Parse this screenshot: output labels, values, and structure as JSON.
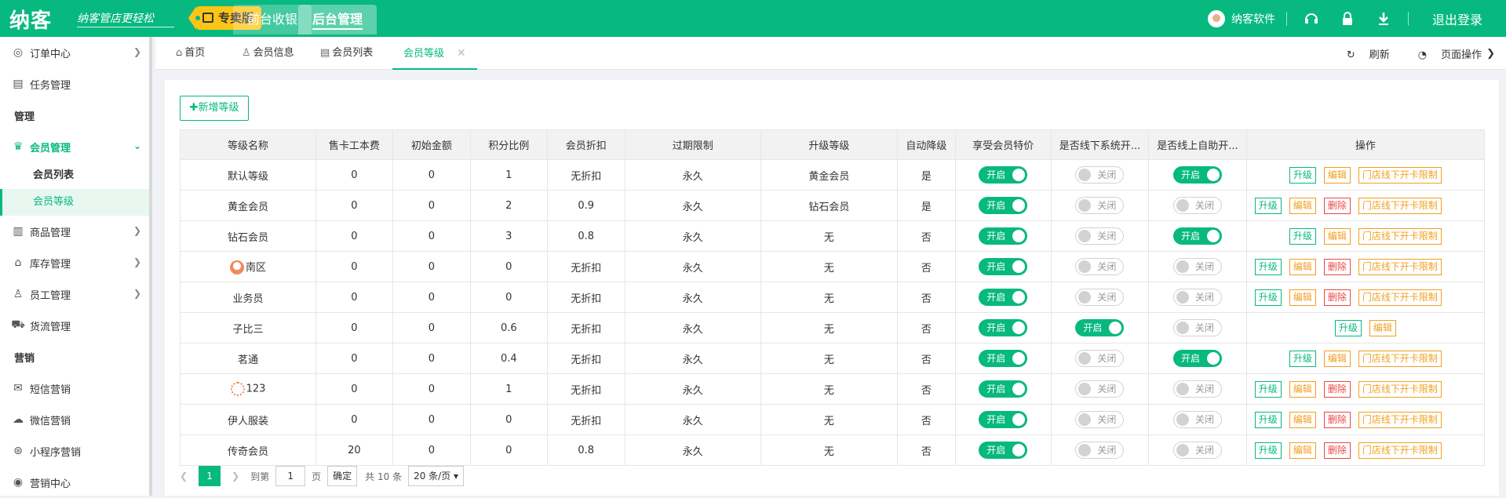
{
  "app": {
    "logo": "纳客",
    "slogan": "纳客管店更轻松",
    "edition": "专卖版"
  },
  "topnav": [
    {
      "label": "前台收银"
    },
    {
      "label": "后台管理"
    }
  ],
  "user": {
    "name": "纳客软件",
    "logout": "退出登录"
  },
  "sidebar": {
    "items": [
      {
        "label": "订单中心",
        "icon": "globe-icon"
      },
      {
        "label": "任务管理",
        "icon": "task-icon"
      },
      {
        "label": "管理"
      },
      {
        "label": "会员管理",
        "icon": "crown-icon"
      },
      {
        "label": "会员列表"
      },
      {
        "label": "会员等级"
      },
      {
        "label": "商品管理",
        "icon": "goods-icon"
      },
      {
        "label": "库存管理",
        "icon": "warehouse-icon"
      },
      {
        "label": "员工管理",
        "icon": "person-icon"
      },
      {
        "label": "货流管理",
        "icon": "truck-icon"
      },
      {
        "label": "营销"
      },
      {
        "label": "短信营销",
        "icon": "mail-icon"
      },
      {
        "label": "微信营销",
        "icon": "wechat-icon"
      },
      {
        "label": "小程序营销",
        "icon": "miniapp-icon"
      },
      {
        "label": "营销中心",
        "icon": "target-icon"
      }
    ]
  },
  "tabs": [
    {
      "label": "首页"
    },
    {
      "label": "会员信息"
    },
    {
      "label": "会员列表"
    },
    {
      "label": "会员等级"
    }
  ],
  "tabbar": {
    "refresh": "刷新",
    "page_ops": "页面操作"
  },
  "toolbar": {
    "add_level": "新增等级"
  },
  "table": {
    "headers": [
      "等级名称",
      "售卡工本费",
      "初始金额",
      "积分比例",
      "会员折扣",
      "过期限制",
      "升级等级",
      "自动降级",
      "享受会员特价",
      "是否线下系统开...",
      "是否线上自助开...",
      "操作"
    ],
    "toggle_on": "开启",
    "toggle_off": "关闭",
    "actions": {
      "upgrade": "升级",
      "edit": "编辑",
      "delete": "删除",
      "limit": "门店线下开卡限制"
    },
    "rows": [
      {
        "name": "默认等级",
        "fee": "0",
        "init": "0",
        "ratio": "1",
        "discount": "无折扣",
        "expire": "永久",
        "upgrade_to": "黄金会员",
        "auto_down": "是",
        "special": true,
        "offline": false,
        "online": true,
        "del": false,
        "limit": true
      },
      {
        "name": "黄金会员",
        "fee": "0",
        "init": "0",
        "ratio": "2",
        "discount": "0.9",
        "expire": "永久",
        "upgrade_to": "钻石会员",
        "auto_down": "是",
        "special": true,
        "offline": false,
        "online": false,
        "del": true,
        "limit": true
      },
      {
        "name": "钻石会员",
        "fee": "0",
        "init": "0",
        "ratio": "3",
        "discount": "0.8",
        "expire": "永久",
        "upgrade_to": "无",
        "auto_down": "否",
        "special": true,
        "offline": false,
        "online": true,
        "del": false,
        "limit": true
      },
      {
        "name": "南区",
        "fee": "0",
        "init": "0",
        "ratio": "0",
        "discount": "无折扣",
        "expire": "永久",
        "upgrade_to": "无",
        "auto_down": "否",
        "special": true,
        "offline": false,
        "online": false,
        "del": true,
        "limit": true,
        "icon": "level-badge-icon"
      },
      {
        "name": "业务员",
        "fee": "0",
        "init": "0",
        "ratio": "0",
        "discount": "无折扣",
        "expire": "永久",
        "upgrade_to": "无",
        "auto_down": "否",
        "special": true,
        "offline": false,
        "online": false,
        "del": true,
        "limit": true
      },
      {
        "name": "子比三",
        "fee": "0",
        "init": "0",
        "ratio": "0.6",
        "discount": "无折扣",
        "expire": "永久",
        "upgrade_to": "无",
        "auto_down": "否",
        "special": true,
        "offline": true,
        "online": false,
        "del": false,
        "limit": false
      },
      {
        "name": "茗通",
        "fee": "0",
        "init": "0",
        "ratio": "0.4",
        "discount": "无折扣",
        "expire": "永久",
        "upgrade_to": "无",
        "auto_down": "否",
        "special": true,
        "offline": false,
        "online": true,
        "del": false,
        "limit": true
      },
      {
        "name": "123",
        "fee": "0",
        "init": "0",
        "ratio": "1",
        "discount": "无折扣",
        "expire": "永久",
        "upgrade_to": "无",
        "auto_down": "否",
        "special": true,
        "offline": false,
        "online": false,
        "del": true,
        "limit": true,
        "icon": "level-ring-icon"
      },
      {
        "name": "伊人服装",
        "fee": "0",
        "init": "0",
        "ratio": "0",
        "discount": "无折扣",
        "expire": "永久",
        "upgrade_to": "无",
        "auto_down": "否",
        "special": true,
        "offline": false,
        "online": false,
        "del": true,
        "limit": true
      },
      {
        "name": "传奇会员",
        "fee": "20",
        "init": "0",
        "ratio": "0",
        "discount": "0.8",
        "expire": "永久",
        "upgrade_to": "无",
        "auto_down": "否",
        "special": true,
        "offline": false,
        "online": false,
        "del": true,
        "limit": true
      }
    ]
  },
  "pagination": {
    "current": "1",
    "goto_label": "到第",
    "page_value": "1",
    "page_unit": "页",
    "confirm": "确定",
    "total": "共 10 条",
    "page_size": "20 条/页"
  },
  "colors": {
    "primary": "#07b97f",
    "edition": "#ffc516",
    "warn": "#f0a020",
    "danger": "#e84848"
  }
}
